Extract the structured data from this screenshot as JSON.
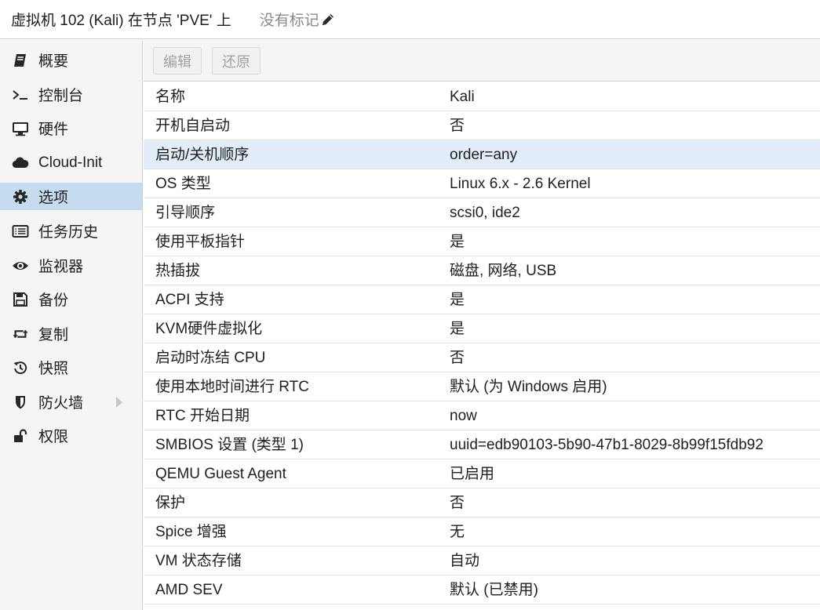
{
  "header": {
    "title": "虚拟机 102 (Kali) 在节点 'PVE' 上",
    "tags_label": "没有标记"
  },
  "sidebar": {
    "items": [
      {
        "label": "概要",
        "icon": "book-icon"
      },
      {
        "label": "控制台",
        "icon": "terminal-icon"
      },
      {
        "label": "硬件",
        "icon": "desktop-icon"
      },
      {
        "label": "Cloud-Init",
        "icon": "cloud-icon"
      },
      {
        "label": "选项",
        "icon": "gear-icon",
        "active": true
      },
      {
        "label": "任务历史",
        "icon": "list-icon"
      },
      {
        "label": "监视器",
        "icon": "eye-icon"
      },
      {
        "label": "备份",
        "icon": "floppy-icon"
      },
      {
        "label": "复制",
        "icon": "retweet-icon"
      },
      {
        "label": "快照",
        "icon": "history-icon"
      },
      {
        "label": "防火墙",
        "icon": "shield-icon",
        "expandable": true
      },
      {
        "label": "权限",
        "icon": "unlock-icon"
      }
    ]
  },
  "toolbar": {
    "edit_label": "编辑",
    "revert_label": "还原"
  },
  "options": {
    "rows": [
      {
        "name": "名称",
        "value": "Kali"
      },
      {
        "name": "开机自启动",
        "value": "否"
      },
      {
        "name": "启动/关机顺序",
        "value": "order=any",
        "selected": true
      },
      {
        "name": "OS 类型",
        "value": "Linux 6.x - 2.6 Kernel"
      },
      {
        "name": "引导顺序",
        "value": "scsi0, ide2"
      },
      {
        "name": "使用平板指针",
        "value": "是"
      },
      {
        "name": "热插拔",
        "value": "磁盘, 网络, USB"
      },
      {
        "name": "ACPI 支持",
        "value": "是"
      },
      {
        "name": "KVM硬件虚拟化",
        "value": "是"
      },
      {
        "name": "启动时冻结 CPU",
        "value": "否"
      },
      {
        "name": "使用本地时间进行 RTC",
        "value": "默认 (为 Windows 启用)"
      },
      {
        "name": "RTC 开始日期",
        "value": "now"
      },
      {
        "name": "SMBIOS 设置 (类型 1)",
        "value": "uuid=edb90103-5b90-47b1-8029-8b99f15fdb92"
      },
      {
        "name": "QEMU Guest Agent",
        "value": "已启用"
      },
      {
        "name": "保护",
        "value": "否"
      },
      {
        "name": "Spice 增强",
        "value": "无"
      },
      {
        "name": "VM 状态存储",
        "value": "自动"
      },
      {
        "name": "AMD SEV",
        "value": "默认 (已禁用)"
      }
    ]
  },
  "colors": {
    "accent_selected": "#c5dcef",
    "row_selected": "#e1edf8",
    "sidebar_bg": "#f5f5f5",
    "disabled_text": "#a3a3a3"
  }
}
